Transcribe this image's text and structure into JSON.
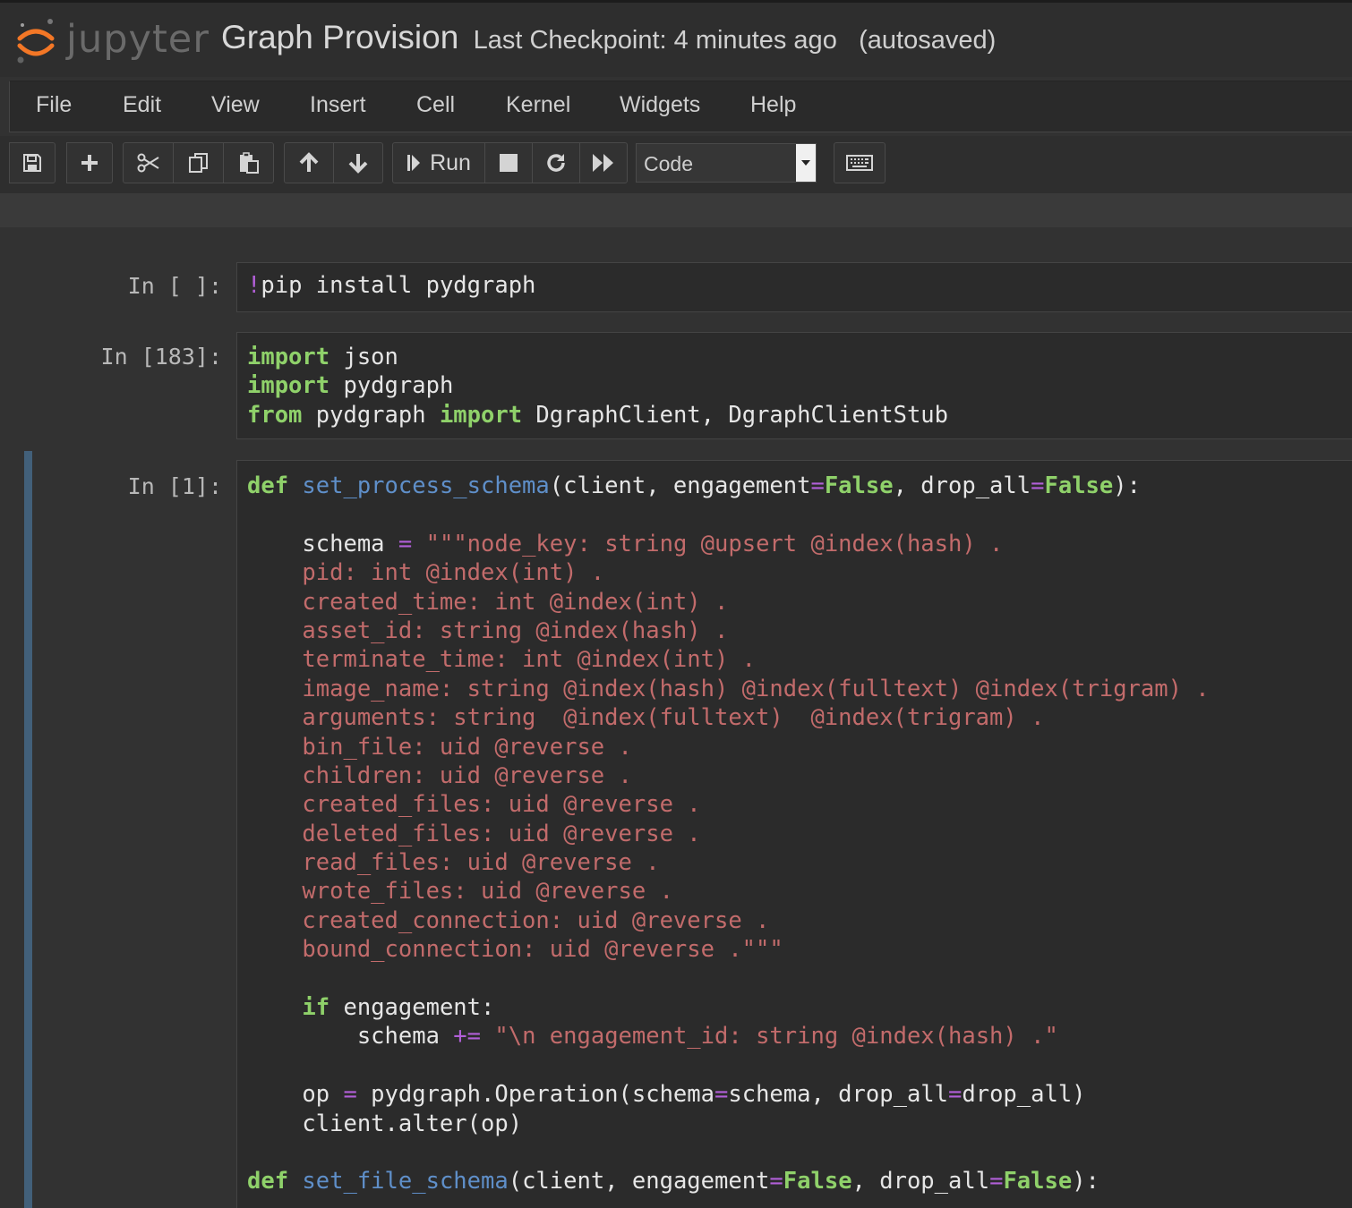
{
  "app": {
    "logo_text": "jupyter",
    "notebook_name": "Graph Provision",
    "checkpoint": "Last Checkpoint: 4 minutes ago",
    "autosave": "(autosaved)"
  },
  "menu": {
    "file": "File",
    "edit": "Edit",
    "view": "View",
    "insert": "Insert",
    "cell": "Cell",
    "kernel": "Kernel",
    "widgets": "Widgets",
    "help": "Help"
  },
  "toolbar": {
    "run_label": "Run",
    "cell_type": "Code",
    "icons": [
      "save-icon",
      "plus-icon",
      "cut-icon",
      "copy-icon",
      "paste-icon",
      "arrow-up-icon",
      "arrow-down-icon",
      "step-forward-icon",
      "stop-icon",
      "restart-icon",
      "fast-forward-icon",
      "keyboard-icon"
    ]
  },
  "cells": [
    {
      "prompt": "In [ ]:",
      "lines": [
        [
          [
            "mg",
            "!"
          ],
          [
            "",
            "pip install pydgraph"
          ]
        ]
      ]
    },
    {
      "prompt": "In [183]:",
      "lines": [
        [
          [
            "kw",
            "import"
          ],
          [
            "",
            " json"
          ]
        ],
        [
          [
            "kw",
            "import"
          ],
          [
            "",
            " pydgraph"
          ]
        ],
        [
          [
            "kw",
            "from"
          ],
          [
            "",
            " pydgraph "
          ],
          [
            "kw",
            "import"
          ],
          [
            "",
            " DgraphClient, DgraphClientStub"
          ]
        ]
      ]
    },
    {
      "prompt": "In [1]:",
      "lines": [
        [
          [
            "kw",
            "def"
          ],
          [
            "",
            " "
          ],
          [
            "fn",
            "set_process_schema"
          ],
          [
            "",
            "(client, engagement"
          ],
          [
            "op",
            "="
          ],
          [
            "bi",
            "False"
          ],
          [
            "",
            ", drop_all"
          ],
          [
            "op",
            "="
          ],
          [
            "bi",
            "False"
          ],
          [
            "",
            "):"
          ]
        ],
        [
          [
            "",
            ""
          ]
        ],
        [
          [
            "",
            "    schema "
          ],
          [
            "op",
            "="
          ],
          [
            "",
            " "
          ],
          [
            "st",
            "\"\"\"node_key: string @upsert @index(hash) ."
          ]
        ],
        [
          [
            "st",
            "    pid: int @index(int) ."
          ]
        ],
        [
          [
            "st",
            "    created_time: int @index(int) ."
          ]
        ],
        [
          [
            "st",
            "    asset_id: string @index(hash) ."
          ]
        ],
        [
          [
            "st",
            "    terminate_time: int @index(int) ."
          ]
        ],
        [
          [
            "st",
            "    image_name: string @index(hash) @index(fulltext) @index(trigram) ."
          ]
        ],
        [
          [
            "st",
            "    arguments: string  @index(fulltext)  @index(trigram) ."
          ]
        ],
        [
          [
            "st",
            "    bin_file: uid @reverse ."
          ]
        ],
        [
          [
            "st",
            "    children: uid @reverse ."
          ]
        ],
        [
          [
            "st",
            "    created_files: uid @reverse ."
          ]
        ],
        [
          [
            "st",
            "    deleted_files: uid @reverse ."
          ]
        ],
        [
          [
            "st",
            "    read_files: uid @reverse ."
          ]
        ],
        [
          [
            "st",
            "    wrote_files: uid @reverse ."
          ]
        ],
        [
          [
            "st",
            "    created_connection: uid @reverse ."
          ]
        ],
        [
          [
            "st",
            "    bound_connection: uid @reverse .\"\"\""
          ]
        ],
        [
          [
            "",
            ""
          ]
        ],
        [
          [
            "",
            "    "
          ],
          [
            "kw",
            "if"
          ],
          [
            "",
            " engagement:"
          ]
        ],
        [
          [
            "",
            "        schema "
          ],
          [
            "op",
            "+="
          ],
          [
            "",
            " "
          ],
          [
            "st",
            "\"\\n engagement_id: string @index(hash) .\""
          ]
        ],
        [
          [
            "",
            ""
          ]
        ],
        [
          [
            "",
            "    op "
          ],
          [
            "op",
            "="
          ],
          [
            "",
            " pydgraph.Operation(schema"
          ],
          [
            "op",
            "="
          ],
          [
            "",
            "schema, drop_all"
          ],
          [
            "op",
            "="
          ],
          [
            "",
            "drop_all)"
          ]
        ],
        [
          [
            "",
            "    client.alter(op)"
          ]
        ],
        [
          [
            "",
            ""
          ]
        ],
        [
          [
            "kw",
            "def"
          ],
          [
            "",
            " "
          ],
          [
            "fn",
            "set_file_schema"
          ],
          [
            "",
            "(client, engagement"
          ],
          [
            "op",
            "="
          ],
          [
            "bi",
            "False"
          ],
          [
            "",
            ", drop_all"
          ],
          [
            "op",
            "="
          ],
          [
            "bi",
            "False"
          ],
          [
            "",
            "):"
          ]
        ]
      ]
    }
  ]
}
